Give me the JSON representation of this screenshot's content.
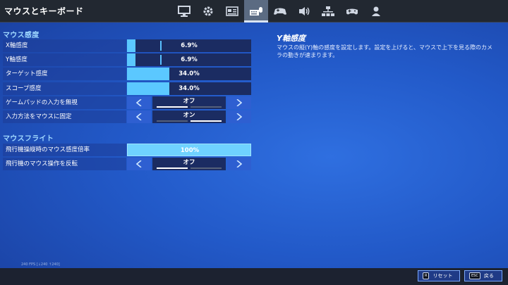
{
  "header": {
    "title": "マウスとキーボード",
    "tabs": [
      {
        "icon": "monitor-icon"
      },
      {
        "icon": "gear-icon"
      },
      {
        "icon": "picture-icon"
      },
      {
        "icon": "keyboard-mouse-icon",
        "active": true
      },
      {
        "icon": "gamepad-controller-icon"
      },
      {
        "icon": "speaker-icon"
      },
      {
        "icon": "network-icon"
      },
      {
        "icon": "gamepad-icon"
      },
      {
        "icon": "person-icon"
      }
    ]
  },
  "sections": {
    "mouse": {
      "title": "マウス感度",
      "x_sensitivity": {
        "label": "X軸感度",
        "value": "6.9%",
        "level": 0.069
      },
      "y_sensitivity": {
        "label": "Y軸感度",
        "value": "6.9%",
        "level": 0.069
      },
      "target_sensitivity": {
        "label": "ターゲット感度",
        "value": "34.0%",
        "level": 0.34
      },
      "scope_sensitivity": {
        "label": "スコープ感度",
        "value": "34.0%",
        "level": 0.34
      },
      "ignore_gamepad": {
        "label": "ゲームパッドの入力を無視",
        "value": "オフ",
        "state": "off"
      },
      "lock_input": {
        "label": "入力方法をマウスに固定",
        "value": "オン",
        "state": "on"
      }
    },
    "flight": {
      "title": "マウスフライト",
      "flight_multiplier": {
        "label": "飛行機操縦時のマウス感度倍率",
        "value": "100%",
        "level": 1.0
      },
      "invert_flight": {
        "label": "飛行機のマウス操作を反転",
        "value": "オフ",
        "state": "off"
      }
    }
  },
  "description": {
    "title": "Y軸感度",
    "text": "マウスの縦(Y)軸の感度を設定します。設定を上げると、マウスで上下を見る際のカメラの動きが速まります。"
  },
  "fps": "240 FPS [↓240 ↑240]",
  "footer": {
    "reset_key": "R",
    "reset_label": "リセット",
    "back_key": "ESC",
    "back_label": "戻る"
  },
  "colors": {
    "accent": "#5bc8ff",
    "section_title": "#9fd8ff",
    "background": "#2259c8",
    "topbar": "#222831"
  }
}
